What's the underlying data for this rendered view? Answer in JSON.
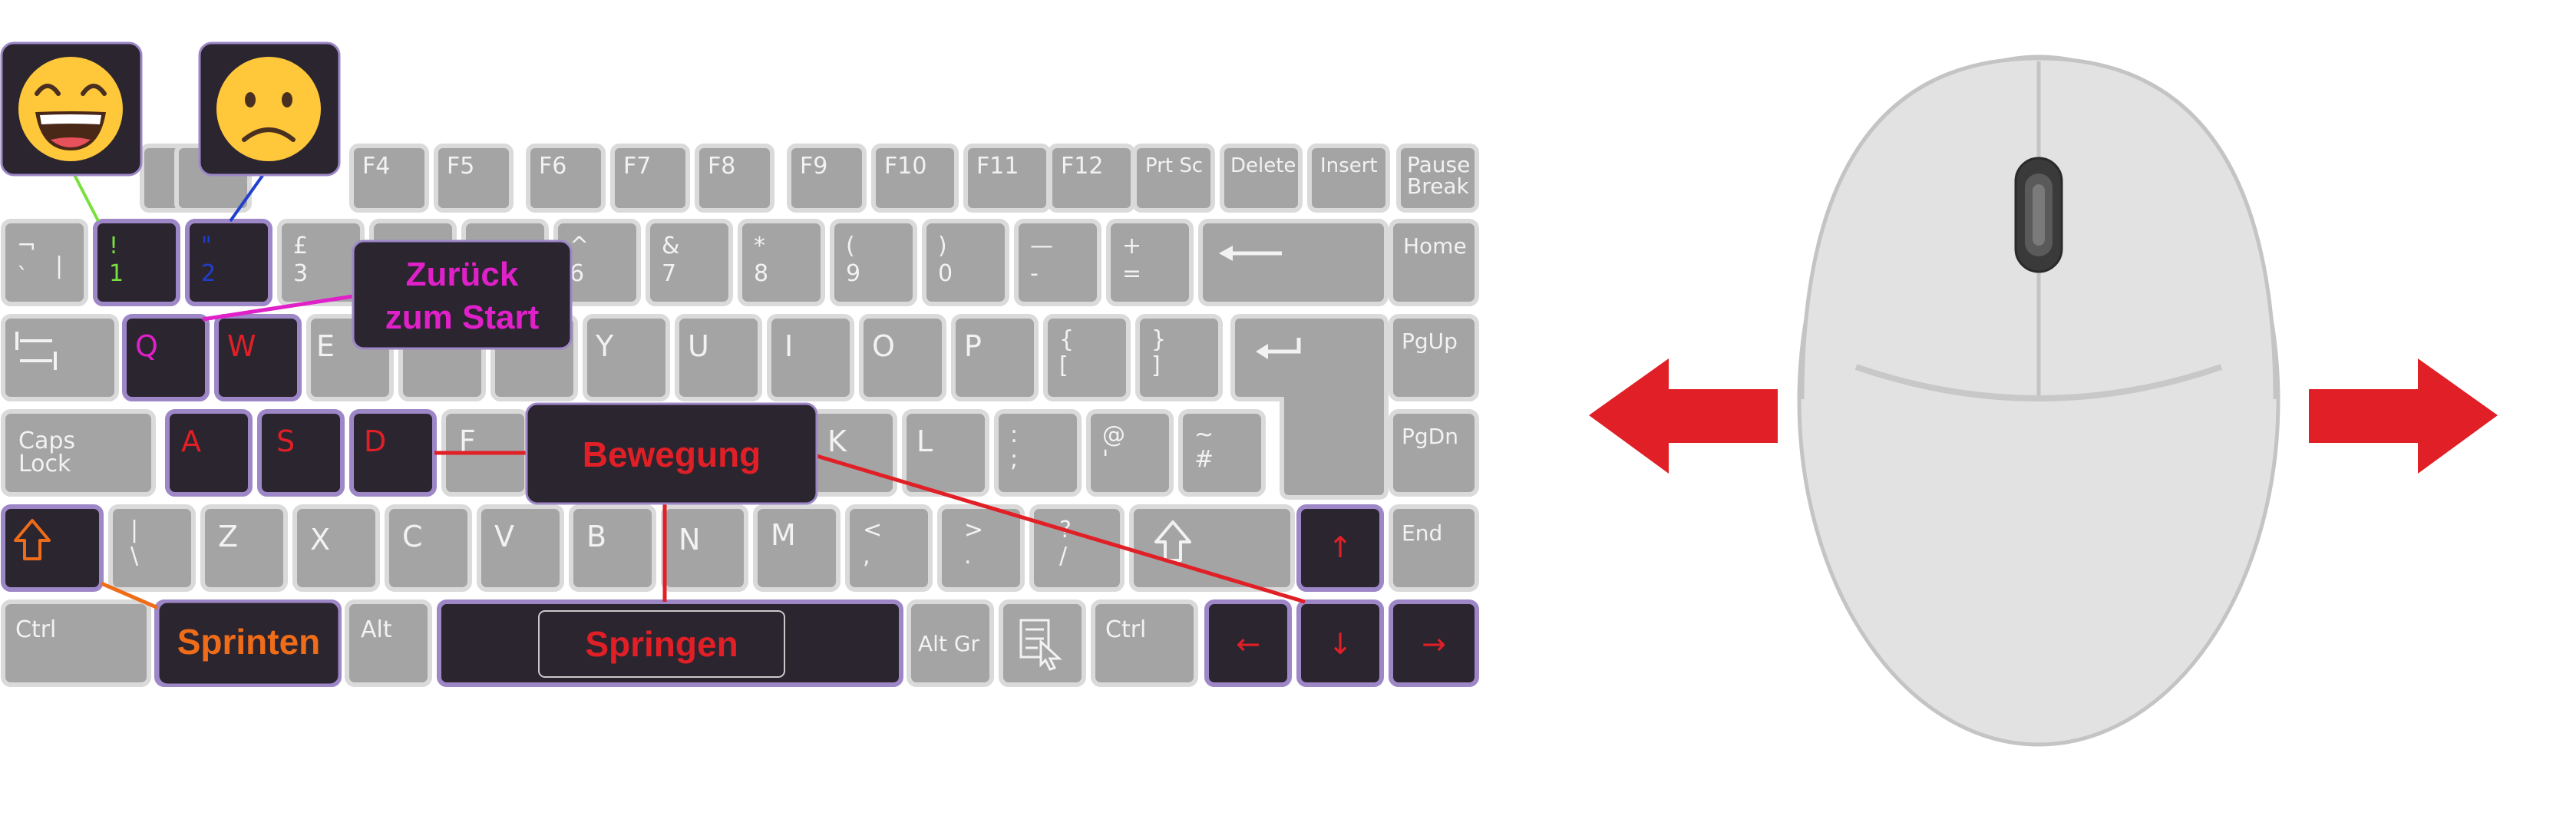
{
  "colors": {
    "key_fill": "#a4a4a4",
    "key_border": "#dadada",
    "key_text": "#f2f2f2",
    "highlight_fill": "#2b2530",
    "highlight_border": "#9d87c7",
    "red": "#e01f26",
    "magenta": "#e020c8",
    "orange": "#ef6c18",
    "green": "#78e03c",
    "blue": "#1f3fd0",
    "mouse_body": "#e2e2e2",
    "mouse_edge": "#c4c4c4"
  },
  "emojis": {
    "happy": "grinning-face",
    "sad": "frowning-face"
  },
  "labels": {
    "back_to_start_line1": "Zurück",
    "back_to_start_line2": "zum Start",
    "movement": "Bewegung",
    "sprint": "Sprinten",
    "jump": "Springen"
  },
  "keys": {
    "row0": [
      "F4",
      "F5",
      "F6",
      "F7",
      "F8",
      "F9",
      "F10",
      "F11",
      "F12",
      "Prt Sc",
      "Delete",
      "Insert",
      "Pause",
      "Break"
    ],
    "row1": [
      "¬",
      "`",
      "|",
      "!",
      "1",
      "\"",
      "2",
      "£",
      "3",
      "^",
      "6",
      "&",
      "7",
      "*",
      "8",
      "(",
      "9",
      ")",
      "0",
      "—",
      "-",
      "+",
      "=",
      "Home"
    ],
    "row2": [
      "Q",
      "W",
      "E",
      "Y",
      "U",
      "I",
      "O",
      "P",
      "{",
      "[",
      "}",
      "]",
      "PgUp"
    ],
    "row3": [
      "Caps",
      "Lock",
      "A",
      "S",
      "D",
      "F",
      "K",
      "L",
      ":",
      ";",
      "@",
      "'",
      "~",
      "#",
      "PgDn"
    ],
    "row4": [
      "|",
      "\\",
      "Z",
      "X",
      "C",
      "V",
      "B",
      "N",
      "M",
      "<",
      ",",
      ">",
      ".",
      "?",
      "/",
      "End"
    ],
    "row5": [
      "Ctrl",
      "Alt",
      "Alt Gr",
      "Ctrl",
      "←",
      "↓",
      "→",
      "↑"
    ]
  },
  "icons": {
    "tab": "tab-icon",
    "enter": "enter-icon",
    "backspace": "backspace-arrow-icon",
    "shift_left": "shift-arrow-icon",
    "shift_right": "shift-arrow-icon",
    "menu": "context-menu-icon",
    "arrow_left": "arrow-left-icon",
    "arrow_right": "arrow-right-icon",
    "mouse": "computer-mouse-icon"
  }
}
